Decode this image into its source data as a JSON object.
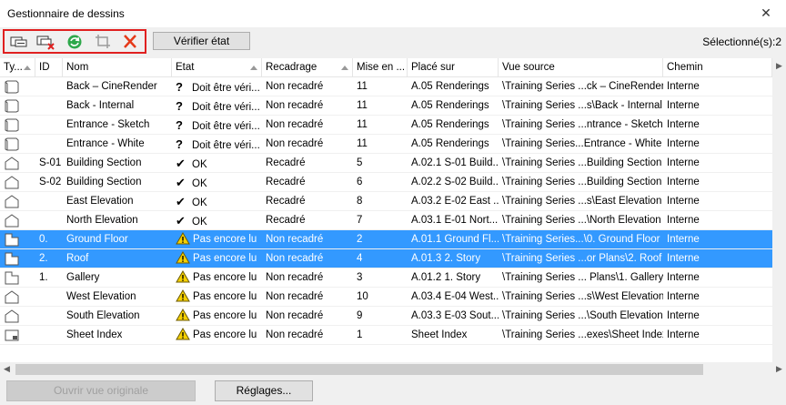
{
  "window": {
    "title": "Gestionnaire de dessins"
  },
  "toolbar": {
    "check_label": "Vérifier état",
    "selected_text": "Sélectionné(s):2",
    "icons": [
      "link-drawing-icon",
      "unlink-drawing-icon",
      "refresh-icon",
      "crop-icon",
      "delete-icon"
    ]
  },
  "columns": [
    "Ty...",
    "ID",
    "Nom",
    "Etat",
    "Recadrage",
    "Mise en ...",
    "Placé sur",
    "Vue source",
    "Chemin"
  ],
  "rows": [
    {
      "type": "3d",
      "id": "",
      "name": "Back – CineRender",
      "status": "Doit être véri...",
      "st": "q",
      "crop": "Non recadré",
      "scale": "11",
      "placed": "A.05 Renderings",
      "source": "\\Training Series ...ck – CineRender",
      "path": "Interne",
      "sel": false
    },
    {
      "type": "3d",
      "id": "",
      "name": "Back - Internal",
      "status": "Doit être véri...",
      "st": "q",
      "crop": "Non recadré",
      "scale": "11",
      "placed": "A.05 Renderings",
      "source": "\\Training Series ...s\\Back - Internal",
      "path": "Interne",
      "sel": false
    },
    {
      "type": "3d",
      "id": "",
      "name": "Entrance - Sketch",
      "status": "Doit être véri...",
      "st": "q",
      "crop": "Non recadré",
      "scale": "11",
      "placed": "A.05 Renderings",
      "source": "\\Training Series ...ntrance - Sketch",
      "path": "Interne",
      "sel": false
    },
    {
      "type": "3d",
      "id": "",
      "name": "Entrance - White",
      "status": "Doit être véri...",
      "st": "q",
      "crop": "Non recadré",
      "scale": "11",
      "placed": "A.05 Renderings",
      "source": "\\Training Series...Entrance - White",
      "path": "Interne",
      "sel": false
    },
    {
      "type": "elev",
      "id": "S-01",
      "name": "Building Section",
      "status": "OK",
      "st": "ok",
      "crop": "Recadré",
      "scale": "5",
      "placed": "A.02.1 S-01 Build...",
      "source": "\\Training Series ...Building Section",
      "path": "Interne",
      "sel": false
    },
    {
      "type": "elev",
      "id": "S-02",
      "name": "Building Section",
      "status": "OK",
      "st": "ok",
      "crop": "Recadré",
      "scale": "6",
      "placed": "A.02.2 S-02 Build...",
      "source": "\\Training Series ...Building Section",
      "path": "Interne",
      "sel": false
    },
    {
      "type": "elev",
      "id": "",
      "name": "East Elevation",
      "status": "OK",
      "st": "ok",
      "crop": "Recadré",
      "scale": "8",
      "placed": "A.03.2 E-02 East ...",
      "source": "\\Training Series ...s\\East Elevation",
      "path": "Interne",
      "sel": false
    },
    {
      "type": "elev",
      "id": "",
      "name": "North Elevation",
      "status": "OK",
      "st": "ok",
      "crop": "Recadré",
      "scale": "7",
      "placed": "A.03.1 E-01 Nort...",
      "source": "\\Training Series ...\\North Elevation",
      "path": "Interne",
      "sel": false
    },
    {
      "type": "plan",
      "id": "0.",
      "name": "Ground Floor",
      "status": "Pas encore lu",
      "st": "warn",
      "crop": "Non recadré",
      "scale": "2",
      "placed": "A.01.1 Ground Fl...",
      "source": "\\Training Series...\\0. Ground Floor",
      "path": "Interne",
      "sel": true
    },
    {
      "type": "plan",
      "id": "2.",
      "name": "Roof",
      "status": "Pas encore lu",
      "st": "warn",
      "crop": "Non recadré",
      "scale": "4",
      "placed": "A.01.3 2. Story",
      "source": "\\Training Series ...or Plans\\2. Roof",
      "path": "Interne",
      "sel": true
    },
    {
      "type": "plan",
      "id": "1.",
      "name": "Gallery",
      "status": "Pas encore lu",
      "st": "warn",
      "crop": "Non recadré",
      "scale": "3",
      "placed": "A.01.2 1. Story",
      "source": "\\Training Series ... Plans\\1. Gallery",
      "path": "Interne",
      "sel": false
    },
    {
      "type": "elev",
      "id": "",
      "name": "West Elevation",
      "status": "Pas encore lu",
      "st": "warn",
      "crop": "Non recadré",
      "scale": "10",
      "placed": "A.03.4 E-04 West...",
      "source": "\\Training Series ...s\\West Elevation",
      "path": "Interne",
      "sel": false
    },
    {
      "type": "elev",
      "id": "",
      "name": "South Elevation",
      "status": "Pas encore lu",
      "st": "warn",
      "crop": "Non recadré",
      "scale": "9",
      "placed": "A.03.3 E-03 Sout...",
      "source": "\\Training Series ...\\South Elevation",
      "path": "Interne",
      "sel": false
    },
    {
      "type": "index",
      "id": "",
      "name": "Sheet Index",
      "status": "Pas encore lu",
      "st": "warn",
      "crop": "Non recadré",
      "scale": "1",
      "placed": "Sheet Index",
      "source": "\\Training Series ...exes\\Sheet Index",
      "path": "Interne",
      "sel": false
    }
  ],
  "footer": {
    "open_original": "Ouvrir vue originale",
    "settings": "Réglages..."
  },
  "colors": {
    "selection": "#3399ff",
    "highlight_box": "#e02020",
    "warning": "#f5d000",
    "refresh": "#2ea84b"
  }
}
